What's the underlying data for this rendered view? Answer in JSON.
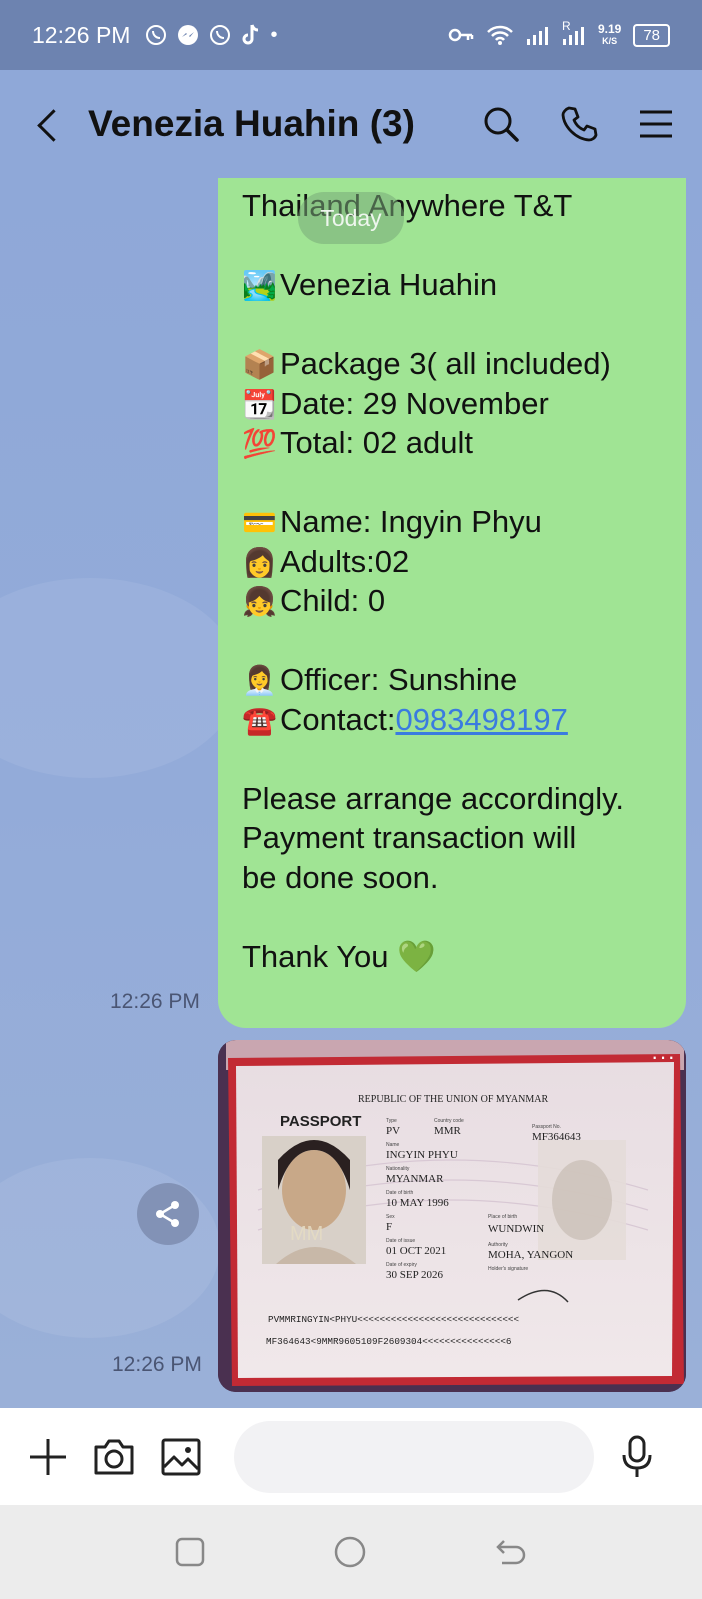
{
  "status_bar": {
    "time": "12:26 PM",
    "network_speed_value": "9.19",
    "network_speed_unit": "K/S",
    "signal_label": "R",
    "battery": "78"
  },
  "header": {
    "title": "Venezia Huahin (3)"
  },
  "chat": {
    "date_divider": "Today",
    "message1": {
      "lines": [
        {
          "emoji": "",
          "text": "Thailand Anywhere T&T"
        },
        {
          "emoji": "🏞️",
          "text": "Venezia Huahin"
        },
        {
          "emoji": "📦",
          "text": "Package 3( all included)"
        },
        {
          "emoji": "📆",
          "text": "Date: 29 November"
        },
        {
          "emoji": "💯",
          "text": "Total: 02 adult"
        },
        {
          "emoji": "💳",
          "text": "Name:  Ingyin Phyu"
        },
        {
          "emoji": "👩",
          "text": "Adults:02"
        },
        {
          "emoji": "👧",
          "text": "Child: 0"
        },
        {
          "emoji": "👩‍💼",
          "text": "Officer: Sunshine"
        },
        {
          "emoji": "☎️",
          "text": "Contact:",
          "link": "0983498197"
        },
        {
          "emoji": "",
          "text": "Please arrange accordingly."
        },
        {
          "emoji": "",
          "text": "Payment  transaction will"
        },
        {
          "emoji": "",
          "text": "be done soon."
        },
        {
          "emoji": "",
          "text": "Thank You 💚"
        }
      ],
      "time": "12:26 PM"
    },
    "message2": {
      "type": "image",
      "time": "12:26 PM",
      "passport": {
        "header": "REPUBLIC OF THE UNION OF MYANMAR",
        "title": "PASSPORT",
        "type": "PV",
        "country_code": "MMR",
        "passport_no": "MF364643",
        "name": "INGYIN PHYU",
        "nationality": "MYANMAR",
        "dob": "10 MAY 1996",
        "sex": "F",
        "place_of_birth": "WUNDWIN",
        "date_of_issue": "01 OCT 2021",
        "authority": "MOHA, YANGON",
        "date_of_expiry": "30 SEP 2026",
        "mrz1": "PVMMRINGYIN<PHYU<<<<<<<<<<<<<<<<<<<<<<<<<<<<<",
        "mrz2": "MF364643<9MMR9605109F2609304<<<<<<<<<<<<<<<6",
        "stamp": "MM",
        "small_labels": {
          "type": "Type",
          "country_code": "Country code",
          "passport_no": "Passport No.",
          "name": "Name",
          "nationality": "Nationality",
          "dob": "Date of birth",
          "sex": "Sex",
          "place_of_birth": "Place of birth",
          "date_of_issue": "Date of issue",
          "authority": "Authority",
          "date_of_expiry": "Date of expiry",
          "signature": "Holder's signature"
        }
      }
    }
  },
  "input": {
    "placeholder": "",
    "value": ""
  },
  "colors": {
    "chat_bg": "#8fa8d8",
    "bubble_green": "#a0e494",
    "status_bar": "#6d83b0",
    "link": "#3a7be0"
  },
  "icons": [
    "back-icon",
    "search-icon",
    "phone-icon",
    "menu-icon",
    "share-icon",
    "plus-icon",
    "camera-icon",
    "gallery-icon",
    "emoji-icon",
    "mic-icon",
    "recent-apps-icon",
    "home-icon",
    "back-nav-icon"
  ]
}
